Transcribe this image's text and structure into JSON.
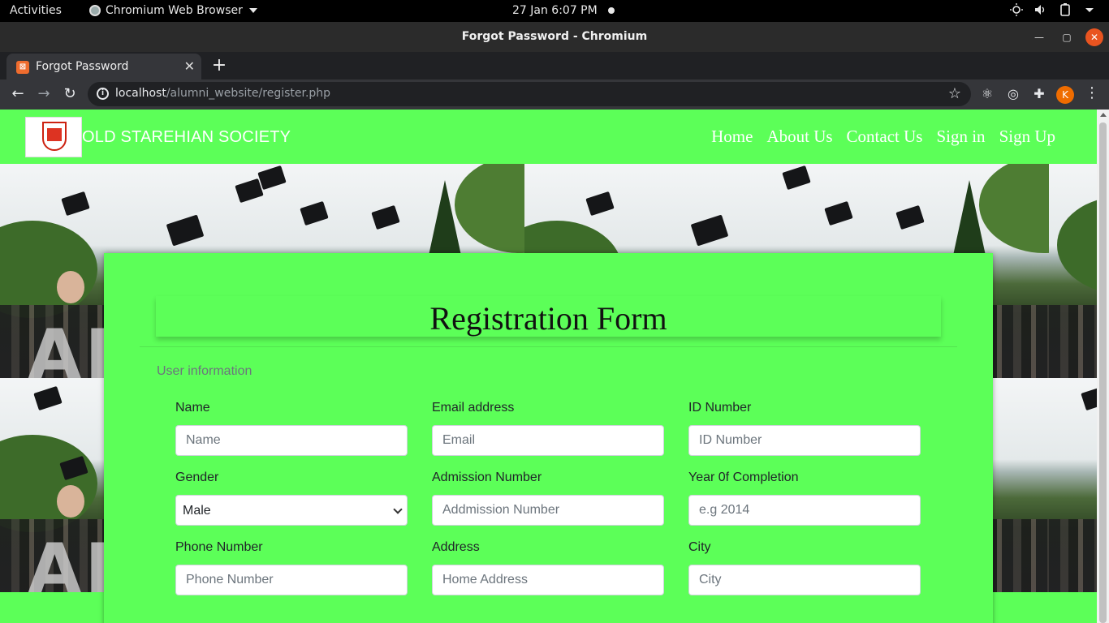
{
  "os_bar": {
    "activities": "Activities",
    "app_name": "Chromium Web Browser",
    "clock": "27 Jan  6:07 PM"
  },
  "window": {
    "title": "Forgot Password - Chromium"
  },
  "tab": {
    "label": "Forgot Password"
  },
  "address_bar": {
    "host": "localhost",
    "path": "/alumni_website/register.php"
  },
  "profile_initial": "K",
  "site": {
    "brand": "OLD STAREHIAN SOCIETY",
    "nav": [
      "Home",
      "About Us",
      "Contact Us",
      "Sign in",
      "Sign Up"
    ],
    "hero_text": "AL"
  },
  "form": {
    "title": "Registration Form",
    "section": "User information",
    "fields": {
      "name": {
        "label": "Name",
        "placeholder": "Name"
      },
      "email": {
        "label": "Email address",
        "placeholder": "Email"
      },
      "id_number": {
        "label": "ID Number",
        "placeholder": "ID Number"
      },
      "gender": {
        "label": "Gender",
        "value": "Male"
      },
      "admission": {
        "label": "Admission Number",
        "placeholder": "Addmission Number"
      },
      "completion": {
        "label": "Year 0f Completion",
        "placeholder": "e.g 2014"
      },
      "phone": {
        "label": "Phone Number",
        "placeholder": "Phone Number"
      },
      "address": {
        "label": "Address",
        "placeholder": "Home Address"
      },
      "city": {
        "label": "City",
        "placeholder": "City"
      }
    }
  },
  "colors": {
    "page_green": "#5cff58",
    "chrome_dark": "#35363a",
    "accent_orange": "#e95420"
  }
}
